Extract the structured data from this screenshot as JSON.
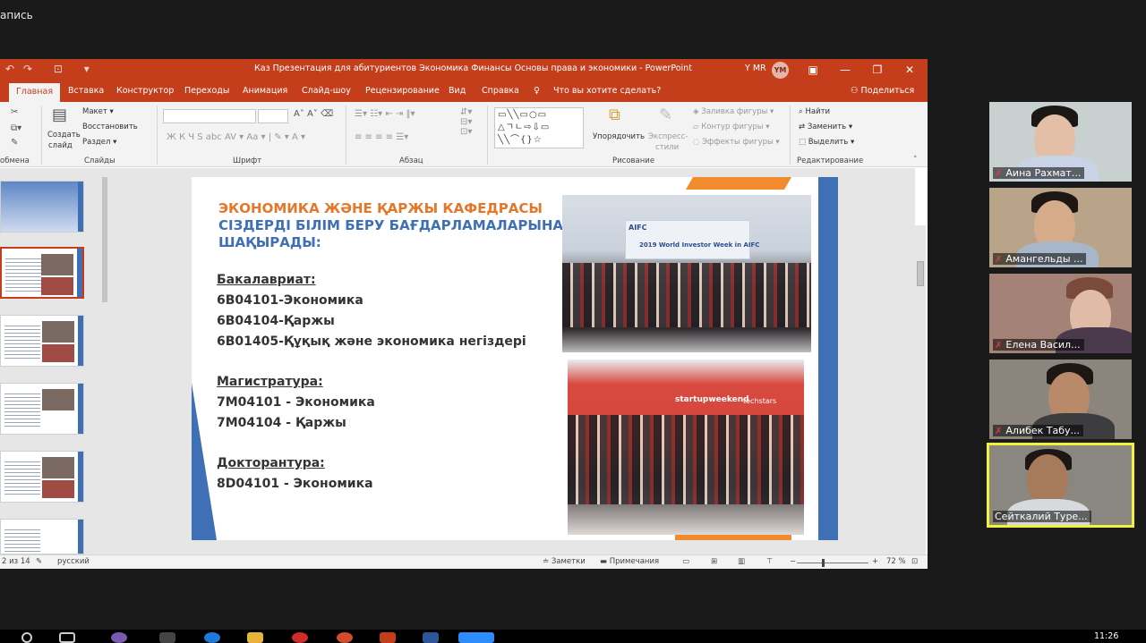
{
  "zoom": {
    "recording_label": "апись",
    "participants": [
      {
        "name": "Аина Рахмат..."
      },
      {
        "name": "Амангельды ..."
      },
      {
        "name": "Елена Васил..."
      },
      {
        "name": "Алибек Табу..."
      },
      {
        "name": "Сейткалий Туре..."
      }
    ]
  },
  "ppt": {
    "window_title": "Каз Презентация для абитуриентов Экономика Финансы Основы права и экономики  -  PowerPoint",
    "user_name": "Y MR",
    "user_initials": "YM",
    "tabs": [
      "Главная",
      "Вставка",
      "Конструктор",
      "Переходы",
      "Анимация",
      "Слайд-шоу",
      "Рецензирование",
      "Вид",
      "Справка",
      "Что вы хотите сделать?"
    ],
    "share_label": "Поделиться",
    "ribbon": {
      "groups": [
        "обмена",
        "Слайды",
        "Шрифт",
        "Абзац",
        "Рисование",
        "Редактирование"
      ],
      "create_slide": "Создать",
      "create_slide2": "слайд",
      "layout": "Макет",
      "restore": "Восстановить",
      "section": "Раздел",
      "arrange": "Упорядочить",
      "express_styles": "Экспресс-",
      "express_styles2": "стили",
      "shape_fill": "Заливка фигуры",
      "shape_outline": "Контур фигуры",
      "shape_effects": "Эффекты фигуры",
      "find": "Найти",
      "replace": "Заменить",
      "select": "Выделить"
    },
    "slide": {
      "title_line1": "ЭКОНОМИКА ЖӘНЕ ҚАРЖЫ КАФЕДРАСЫ",
      "title_line2": "СІЗДЕРДІ БІЛІМ БЕРУ БАҒДАРЛАМАЛАРЫНА",
      "title_line3": "ШАҚЫРАДЫ:",
      "bachelor_head": "Бакалавриат:",
      "bachelor": [
        "6B04101-Экономика",
        "6B04104-Қаржы",
        "6B01405-Құқық және экономика негіздері"
      ],
      "master_head": "Магистратура:",
      "master": [
        "7M04101 - Экономика",
        "7M04104 - Қаржы"
      ],
      "doctor_head": "Докторантура:",
      "doctor": [
        "8D04101 - Экономика"
      ],
      "photo1_banner": "2019 World Investor Week in AIFC",
      "photo1_logo": "AIFC",
      "photo2_banner": "startupweekend",
      "photo2_logo": "techstars"
    },
    "status": {
      "slide_counter": "2 из 14",
      "language": "русский",
      "notes": "Заметки",
      "comments": "Примечания",
      "zoom_level": "72 %",
      "zoom_minus": "−",
      "zoom_plus": "+"
    }
  },
  "taskbar": {
    "time": "11:26"
  }
}
